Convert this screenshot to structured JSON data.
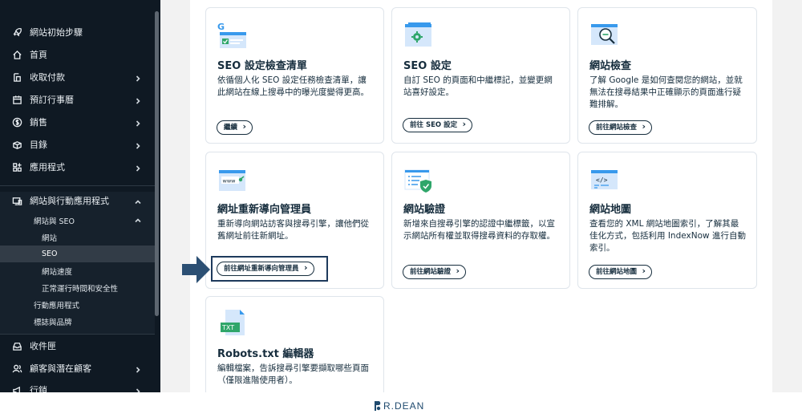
{
  "sidebar": {
    "items": [
      {
        "label": "網站初始步驟",
        "icon": "rocket-icon",
        "chevron": false
      },
      {
        "label": "首頁",
        "icon": "home-icon",
        "chevron": false
      },
      {
        "label": "收取付款",
        "icon": "payment-icon",
        "chevron": true
      },
      {
        "label": "預訂行事曆",
        "icon": "calendar-icon",
        "chevron": true
      },
      {
        "label": "銷售",
        "icon": "dollar-icon",
        "chevron": true
      },
      {
        "label": "目錄",
        "icon": "catalog-icon",
        "chevron": true
      },
      {
        "label": "應用程式",
        "icon": "apps-icon",
        "chevron": true
      },
      {
        "label": "網站與行動應用程式",
        "icon": "devices-icon",
        "chevron": "up"
      }
    ],
    "sub_section": {
      "label": "網站與 SEO"
    },
    "sub_items": [
      "網站",
      "SEO",
      "網站速度",
      "正常運行時間和安全性"
    ],
    "sub_section_items": [
      "行動應用程式",
      "標誌與品牌"
    ],
    "bottom_items": [
      {
        "label": "收件匣",
        "icon": "inbox-icon",
        "chevron": false
      },
      {
        "label": "顧客與潛在顧客",
        "icon": "contacts-icon",
        "chevron": true
      },
      {
        "label": "行銷",
        "icon": "megaphone-icon",
        "chevron": true
      }
    ]
  },
  "cards": [
    {
      "title": "SEO 設定檢查清單",
      "desc": "依循個人化 SEO 設定任務檢查清單，讓此網站在線上搜尋中的曝光度變得更高。",
      "button": "繼續",
      "icon": "google-checklist-icon"
    },
    {
      "title": "SEO 設定",
      "desc": "自訂 SEO 的頁面和中繼標記，並變更網站喜好設定。",
      "button": "前往 SEO 設定",
      "icon": "settings-gear-icon"
    },
    {
      "title": "網站檢查",
      "desc": "了解 Google 是如何查閱您的網站，並就無法在搜尋結果中正確顯示的頁面進行疑難排解。",
      "button": "前往網站檢查",
      "icon": "magnifier-icon"
    },
    {
      "title": "網址重新導向管理員",
      "desc": "重新導向網站訪客與搜尋引擎，讓他們從舊網址前往新網址。",
      "button": "前往網址重新導向管理員",
      "icon": "www-redirect-icon"
    },
    {
      "title": "網站驗證",
      "desc": "新增來自搜尋引擎的認證中繼標籤，以宣示網站所有權並取得搜尋資料的存取權。",
      "button": "前往網站驗證",
      "icon": "shield-verify-icon"
    },
    {
      "title": "網站地圖",
      "desc": "查看您的 XML 網站地圖索引，了解其最佳化方式，包括利用 IndexNow 進行自動索引。",
      "button": "前往網站地圖",
      "icon": "code-sitemap-icon"
    },
    {
      "title": "Robots.txt 編輯器",
      "desc": "編輯檔案，告訴搜尋引擎要擷取哪些頁面（僅限進階使用者）。",
      "button": "",
      "icon": "txt-file-icon",
      "illustration_label": "TXT"
    }
  ],
  "brand": {
    "text": "R.DEAN"
  },
  "colors": {
    "sidebar_bg": "#0f1923",
    "accent_blue": "#3899ec",
    "highlight": "#1e3a5c",
    "green": "#2fa66a"
  }
}
